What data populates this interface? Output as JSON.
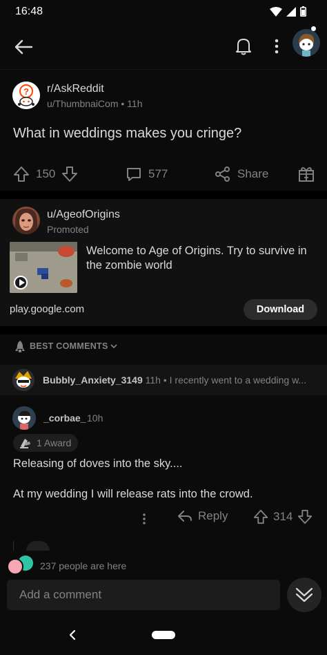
{
  "status_bar": {
    "time": "16:48"
  },
  "app_bar": {
    "actions": [
      "back-arrow-icon",
      "bell-icon",
      "more-vertical-icon",
      "user-avatar"
    ]
  },
  "post": {
    "subreddit": "r/AskReddit",
    "author": "u/ThumbnaiCom",
    "age": "11h",
    "title": "What in weddings makes you cringe?",
    "upvotes": "150",
    "comments": "577",
    "share_label": "Share"
  },
  "ad": {
    "advertiser": "u/AgeofOrigins",
    "promoted_label": "Promoted",
    "text": "Welcome to Age of Origins. Try to survive in the zombie world",
    "domain": "play.google.com",
    "cta_label": "Download"
  },
  "sort": {
    "label": "BEST COMMENTS"
  },
  "collapsed_comment": {
    "author": "Bubbly_Anxiety_3149",
    "age": "11h",
    "preview": "I recently went to  a wedding w..."
  },
  "comment": {
    "author": "_corbae_",
    "age": "10h",
    "award_label": "1 Award",
    "line_1": "Releasing of doves into the sky....",
    "line_2": "At my wedding I will release rats into the crowd.",
    "reply_label": "Reply",
    "score": "314"
  },
  "presence": {
    "text": "237 people are here"
  },
  "composer": {
    "placeholder": "Add a comment"
  },
  "colors": {
    "background": "#0b0b0b",
    "card": "#111111",
    "text_primary": "#d7dadc",
    "text_secondary": "#818384"
  }
}
